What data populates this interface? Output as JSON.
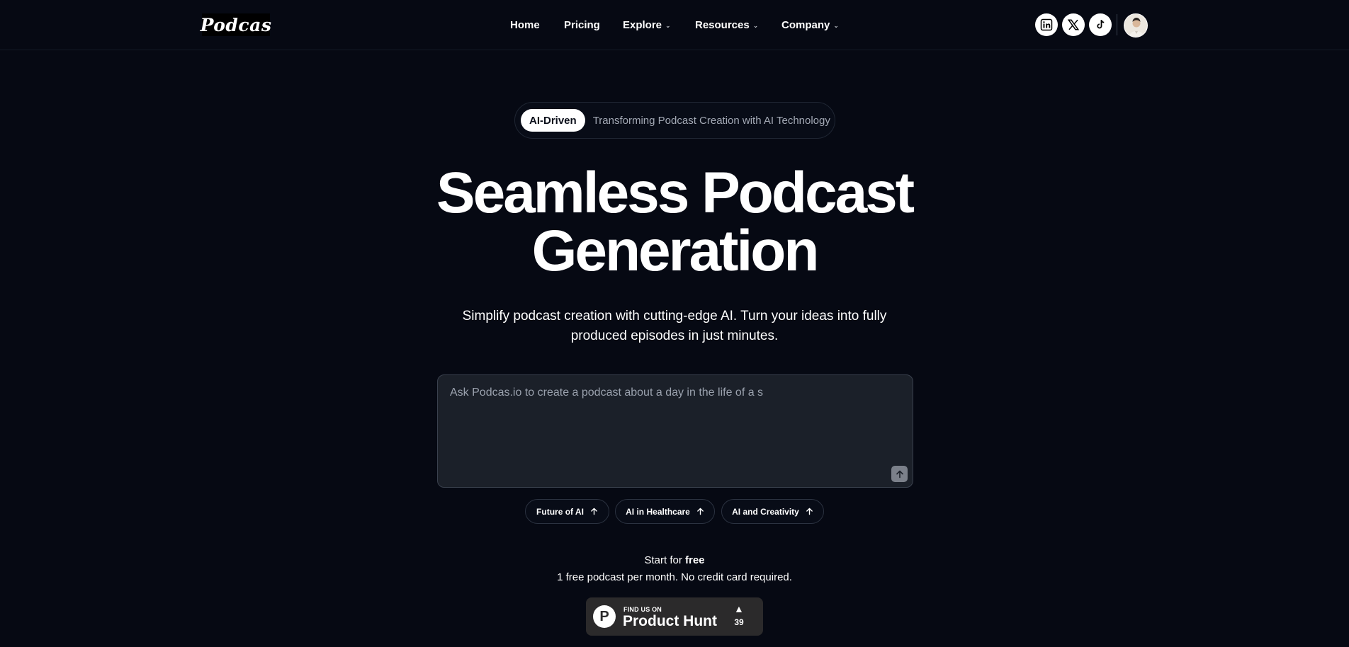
{
  "brand": {
    "logo_text": "Podcas"
  },
  "nav": {
    "items": [
      {
        "label": "Home",
        "dropdown": false
      },
      {
        "label": "Pricing",
        "dropdown": false
      },
      {
        "label": "Explore",
        "dropdown": true
      },
      {
        "label": "Resources",
        "dropdown": true
      },
      {
        "label": "Company",
        "dropdown": true
      }
    ],
    "dropdown_icon": "chevron-down-icon"
  },
  "social": [
    {
      "name": "linkedin",
      "icon": "linkedin-icon"
    },
    {
      "name": "x",
      "icon": "x-icon"
    },
    {
      "name": "tiktok",
      "icon": "tiktok-icon"
    }
  ],
  "badge": {
    "pill": "AI-Driven",
    "text": "Transforming Podcast Creation with AI Technology"
  },
  "hero": {
    "title_line1": "Seamless Podcast",
    "title_line2": "Generation",
    "subtitle_line1": "Simplify podcast creation with cutting-edge AI. Turn your ideas into fully",
    "subtitle_line2": "produced episodes in just minutes."
  },
  "prompt": {
    "placeholder": "Ask Podcas.io to create a podcast about a day in the life of a s",
    "value": "",
    "send_icon": "arrow-up-icon"
  },
  "topics": [
    {
      "label": "Future of AI",
      "icon": "arrow-up-icon"
    },
    {
      "label": "AI in Healthcare",
      "icon": "arrow-up-icon"
    },
    {
      "label": "AI and Creativity",
      "icon": "arrow-up-icon"
    }
  ],
  "cta": {
    "start_prefix": "Start for ",
    "start_bold": "free",
    "note": "1 free podcast per month. No credit card required."
  },
  "product_hunt": {
    "small_label": "FIND US ON",
    "big_label": "Product Hunt",
    "logo_letter": "P",
    "upvote_icon": "triangle-up-icon",
    "votes": "39"
  },
  "colors": {
    "background": "#060913",
    "text": "#ffffff",
    "muted_text": "#a3a9b5",
    "input_bg": "#1b2029",
    "product_hunt_bg": "#2b2a2b"
  }
}
